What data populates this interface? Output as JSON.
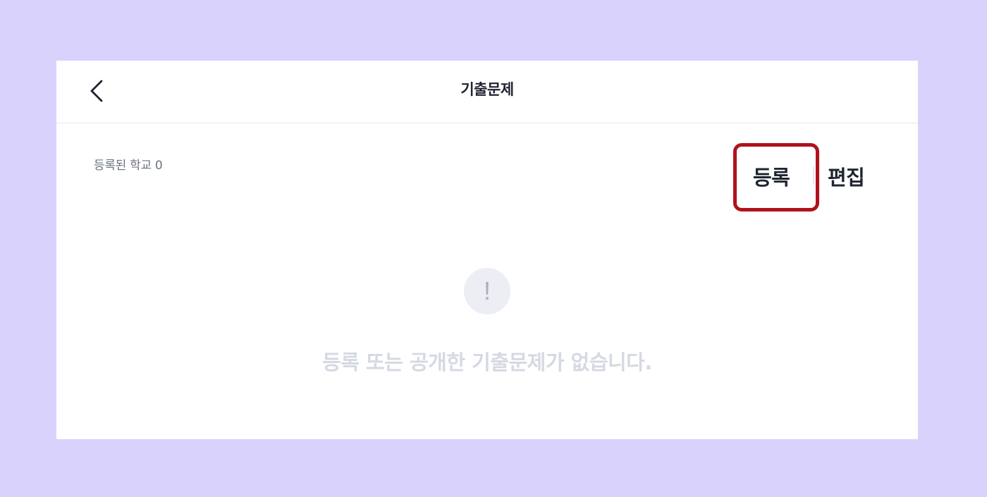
{
  "header": {
    "title": "기출문제",
    "back_icon": "chevron-left-icon"
  },
  "summary": {
    "school_count_label": "등록된 학교 0"
  },
  "actions": {
    "register_label": "등록",
    "edit_label": "편집",
    "highlight_color": "#b0121c"
  },
  "empty_state": {
    "icon_glyph": "!",
    "icon_name": "exclamation-icon",
    "message": "등록 또는 공개한 기출문제가 없습니다."
  },
  "colors": {
    "background": "#d8d2fd",
    "card": "#ffffff",
    "text_primary": "#1d2330",
    "text_muted": "#6b7280",
    "empty_text": "#d5d9e2"
  }
}
